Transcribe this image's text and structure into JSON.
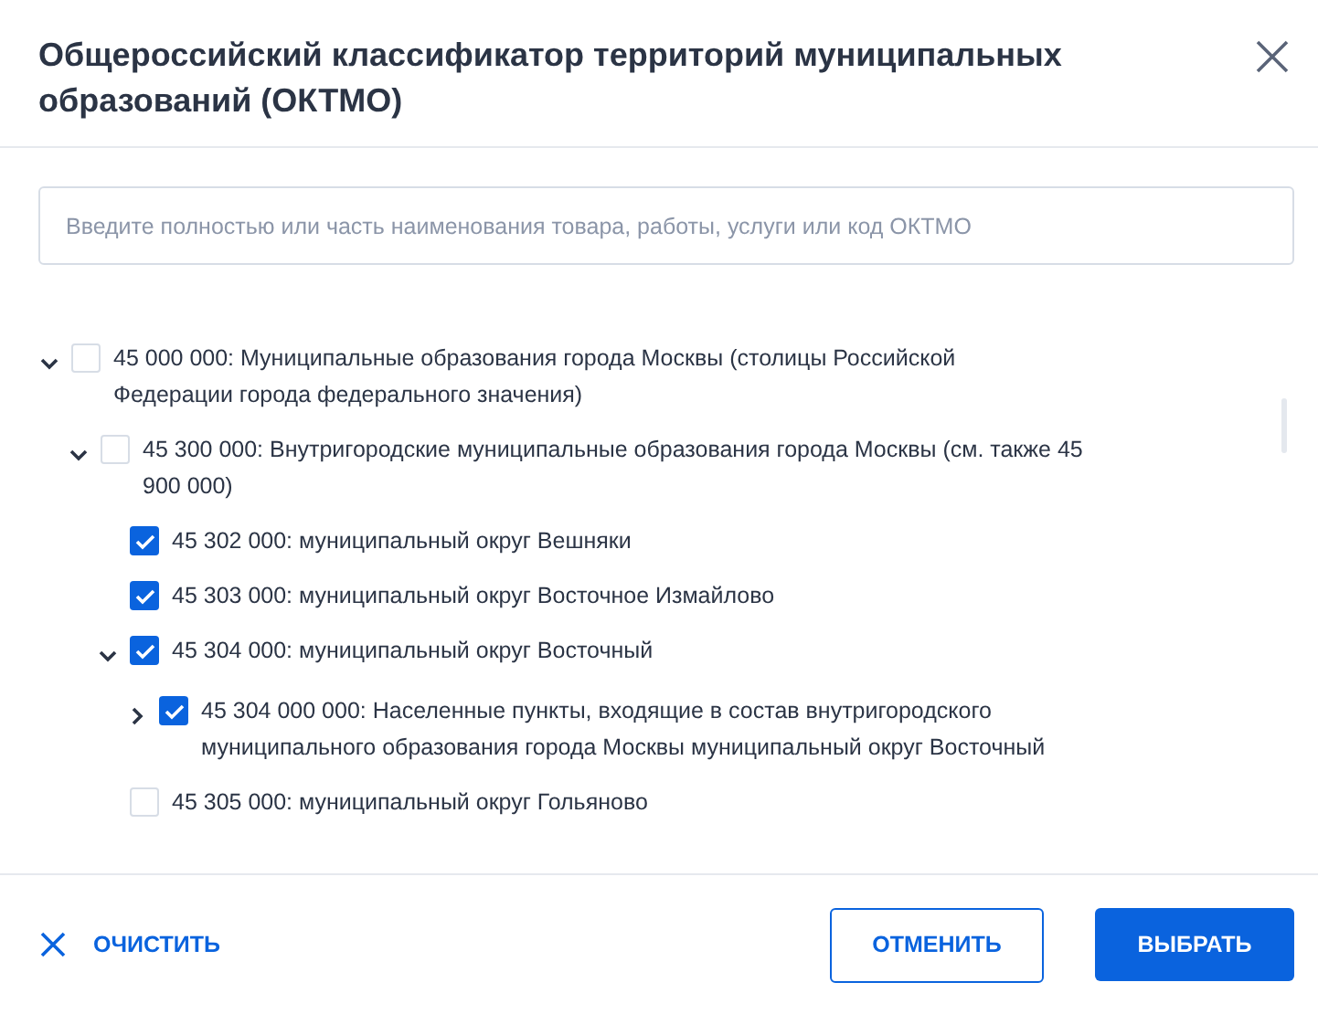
{
  "dialog": {
    "title": "Общероссийский классификатор территорий муниципальных образований (ОКТМО)"
  },
  "search": {
    "placeholder": "Введите полностью или часть наименования товара, работы, услуги или код ОКТМО"
  },
  "tree": [
    {
      "label": "45 000 000: Муниципальные образования города Москвы (столицы Российской Федерации города федерального значения)",
      "checked": false,
      "expanded": true,
      "children": [
        {
          "label": "45 300 000: Внутригородские муниципальные образования города Москвы (см. также 45 900 000)",
          "checked": false,
          "expanded": true,
          "children": [
            {
              "label": "45 302 000: муниципальный округ Вешняки",
              "checked": true
            },
            {
              "label": "45 303 000: муниципальный округ Восточное Измайлово",
              "checked": true
            },
            {
              "label": "45 304 000: муниципальный округ Восточный",
              "checked": true,
              "expanded": true,
              "children": [
                {
                  "label": "45 304 000 000: Населенные пункты, входящие в состав внутригородского муниципального образования города Москвы муниципальный округ Восточный",
                  "checked": true,
                  "expanded": false
                }
              ]
            },
            {
              "label": "45 305 000: муниципальный округ Гольяново",
              "checked": false
            }
          ]
        }
      ]
    }
  ],
  "footer": {
    "clear": "ОЧИСТИТЬ",
    "cancel": "ОТМЕНИТЬ",
    "select": "ВЫБРАТЬ"
  }
}
